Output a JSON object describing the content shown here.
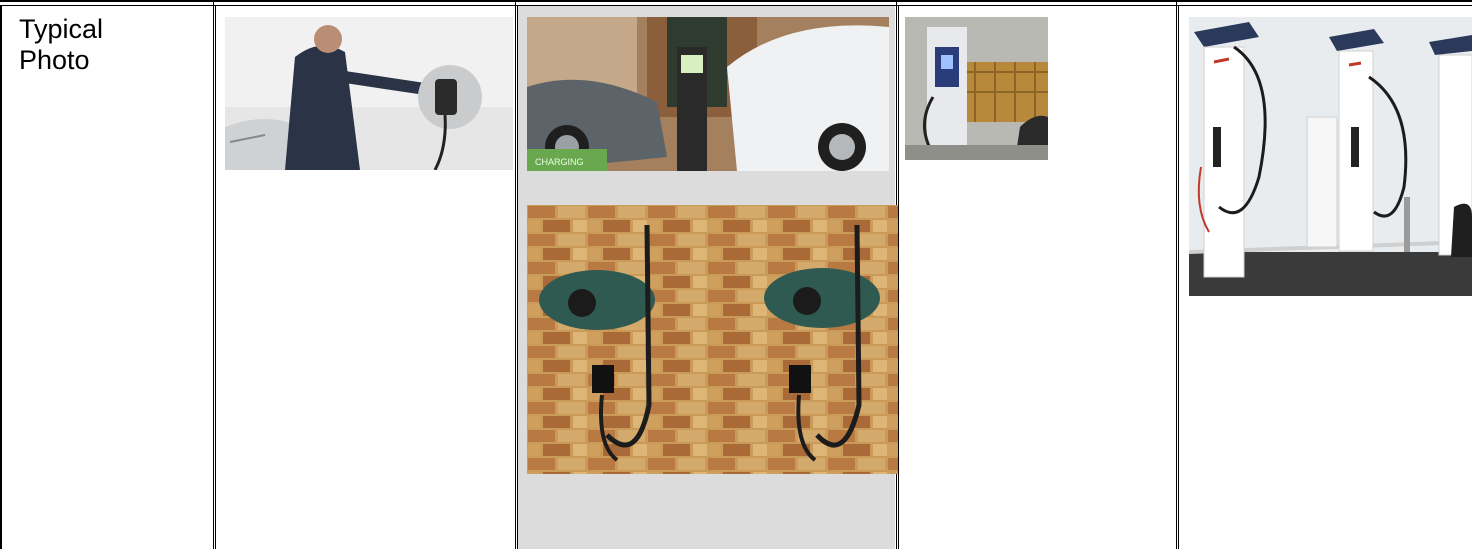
{
  "table": {
    "row_label": "Typical\nPhoto"
  },
  "photos": [
    {
      "alt": "home-wall-charger-photo"
    },
    {
      "alt": "street-charging-post-photo"
    },
    {
      "alt": "wall-mounted-twin-chargers-photo"
    },
    {
      "alt": "rapid-charger-unit-photo"
    },
    {
      "alt": "ultra-rapid-charging-station-photo"
    }
  ],
  "colors": {
    "border": "#000000",
    "shaded_cell": "#dcdcdc",
    "brick": "#a86a3c",
    "charger_green": "#2f5a52",
    "sky": "#e9ecef"
  }
}
